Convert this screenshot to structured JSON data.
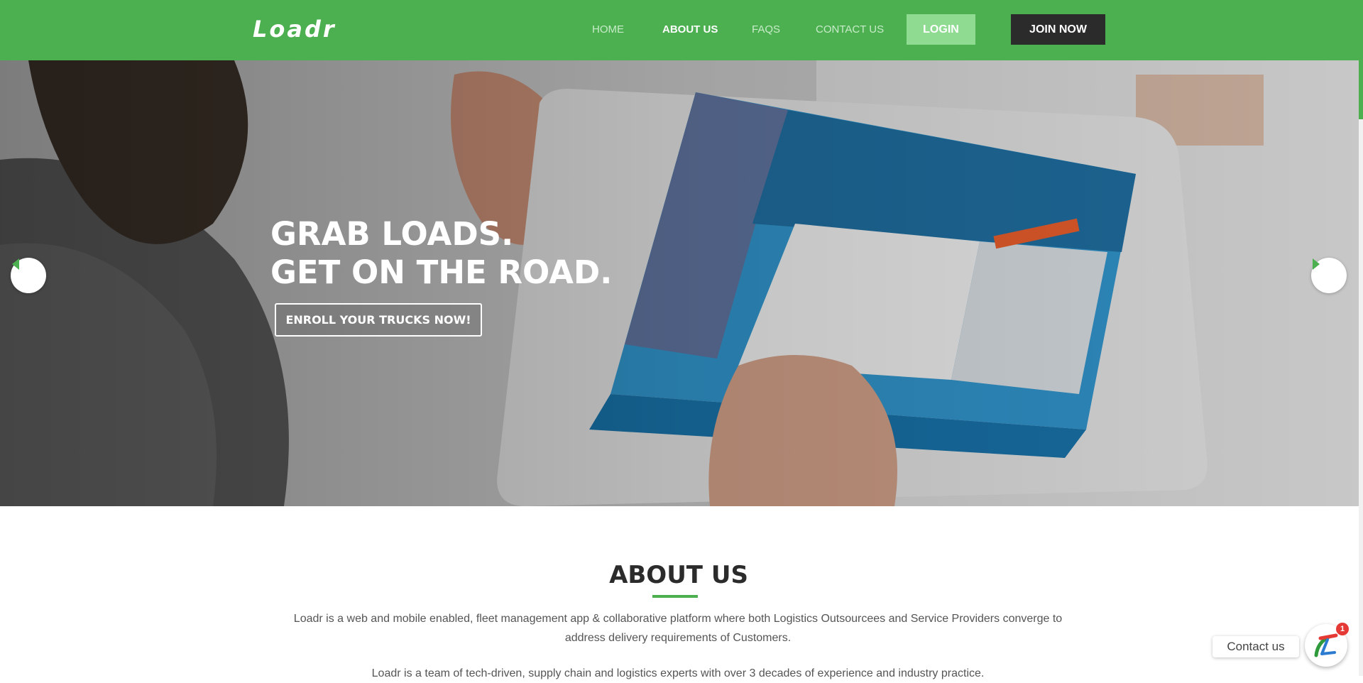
{
  "brand": {
    "logo": "Loadr",
    "accent": "#4caf50"
  },
  "nav": {
    "items": [
      {
        "label": "HOME"
      },
      {
        "label": "ABOUT US",
        "active": true
      },
      {
        "label": "FAQS"
      },
      {
        "label": "CONTACT US"
      }
    ],
    "login_label": "LOGIN",
    "join_label": "JOIN NOW"
  },
  "hero": {
    "line1": "GRAB LOADS.",
    "line2": "GET ON THE ROAD.",
    "cta": "ENROLL YOUR TRUCKS NOW!",
    "prev_icon": "chevron-left-icon",
    "next_icon": "chevron-right-icon"
  },
  "about": {
    "title": "ABOUT US",
    "p1": "Loadr is a web and mobile enabled, fleet management app & collaborative platform where both Logistics Outsourcees and Service Providers converge to address delivery requirements of Customers.",
    "p2": "Loadr is a team of tech-driven, supply chain and logistics experts with over 3 decades of experience and industry practice."
  },
  "chat": {
    "label": "Contact us",
    "badge": "1",
    "icon": "chat-logo-icon"
  }
}
